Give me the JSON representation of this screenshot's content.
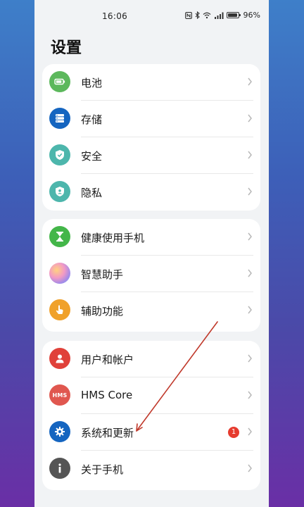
{
  "status_bar": {
    "time": "16:06",
    "icons": [
      "nfc-icon",
      "bluetooth-icon",
      "wifi-icon",
      "signal-icon"
    ],
    "battery_level": 0.96,
    "battery_text": "96%"
  },
  "page": {
    "title": "设置"
  },
  "groups": [
    {
      "items": [
        {
          "label": "电池",
          "icon": "battery-icon",
          "color": "#5cb85c"
        },
        {
          "label": "存储",
          "icon": "storage-icon",
          "color": "#1565c0"
        },
        {
          "label": "安全",
          "icon": "shield-check-icon",
          "color": "#4db6ac"
        },
        {
          "label": "隐私",
          "icon": "privacy-shield-icon",
          "color": "#4db6ac"
        }
      ]
    },
    {
      "items": [
        {
          "label": "健康使用手机",
          "icon": "hourglass-icon",
          "color": "#43b649"
        },
        {
          "label": "智慧助手",
          "icon": "assistant-orb-icon",
          "color": "#b58be0"
        },
        {
          "label": "辅助功能",
          "icon": "hand-pointer-icon",
          "color": "#f0a12a"
        }
      ]
    },
    {
      "items": [
        {
          "label": "用户和帐户",
          "icon": "user-icon",
          "color": "#e0413a"
        },
        {
          "label": "HMS Core",
          "icon": "hms-icon",
          "color": "#e0574f",
          "icon_text": "HMS"
        },
        {
          "label": "系统和更新",
          "icon": "gear-icon",
          "color": "#1565c0",
          "badge": "1"
        },
        {
          "label": "关于手机",
          "icon": "info-icon",
          "color": "#555555"
        }
      ]
    }
  ]
}
